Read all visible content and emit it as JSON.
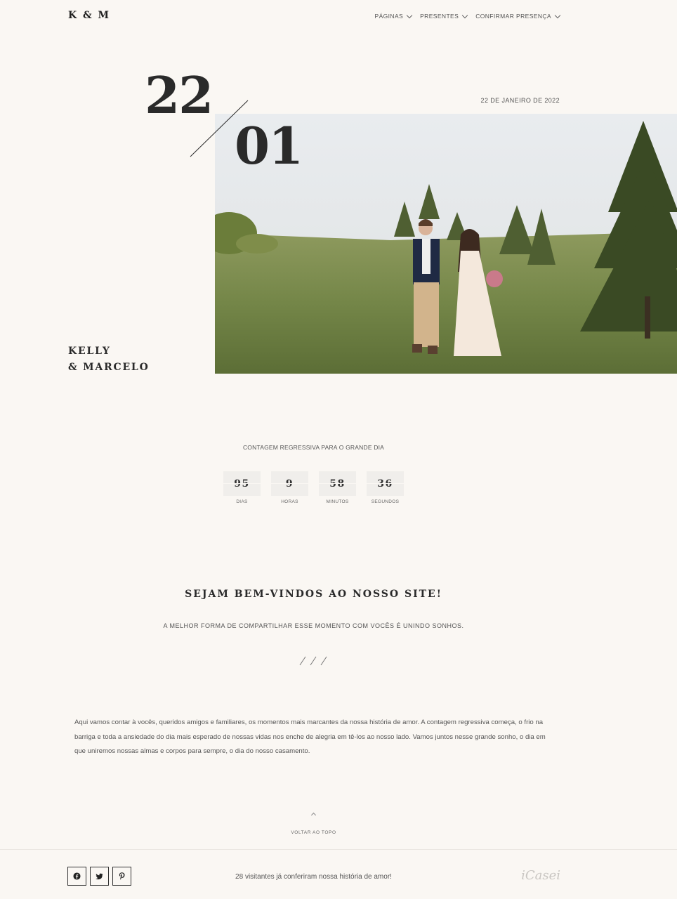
{
  "header": {
    "logo": "K & M",
    "nav": [
      {
        "label": "PÁGINAS"
      },
      {
        "label": "PRESENTES"
      },
      {
        "label": "CONFIRMAR PRESENÇA"
      }
    ]
  },
  "hero": {
    "day": "22",
    "month": "01",
    "date_text": "22 DE JANEIRO DE 2022",
    "name_line1": "KELLY",
    "name_line2": "& MARCELO"
  },
  "countdown": {
    "title": "CONTAGEM REGRESSIVA PARA O GRANDE DIA",
    "units": [
      {
        "value": "95",
        "label": "DIAS"
      },
      {
        "value": "9",
        "label": "HORAS"
      },
      {
        "value": "58",
        "label": "MINUTOS"
      },
      {
        "value": "36",
        "label": "SEGUNDOS"
      }
    ]
  },
  "welcome": {
    "title": "SEJAM BEM-VINDOS AO NOSSO SITE!",
    "subtitle": "A MELHOR FORMA DE COMPARTILHAR ESSE MOMENTO COM VOCÊS É UNINDO SONHOS.",
    "story": "Aqui vamos contar à vocês, queridos amigos e familiares, os momentos mais marcantes da nossa história de amor. A contagem regressiva começa, o frio na barriga e toda a ansiedade do dia mais esperado de nossas vidas nos enche de alegria em tê-los ao nosso lado. Vamos juntos nesse grande sonho, o dia em que uniremos nossas almas e corpos para sempre, o dia do nosso casamento."
  },
  "back_to_top": "VOLTAR AO TOPO",
  "footer": {
    "socials": [
      "facebook-icon",
      "twitter-icon",
      "pinterest-icon"
    ],
    "visitors_text": "28 visitantes já conferiram nossa história de amor!",
    "brand": "iCasei"
  },
  "colors": {
    "background": "#faf7f3",
    "text": "#2b2b2b",
    "countdown_box": "#f0eeeb"
  }
}
